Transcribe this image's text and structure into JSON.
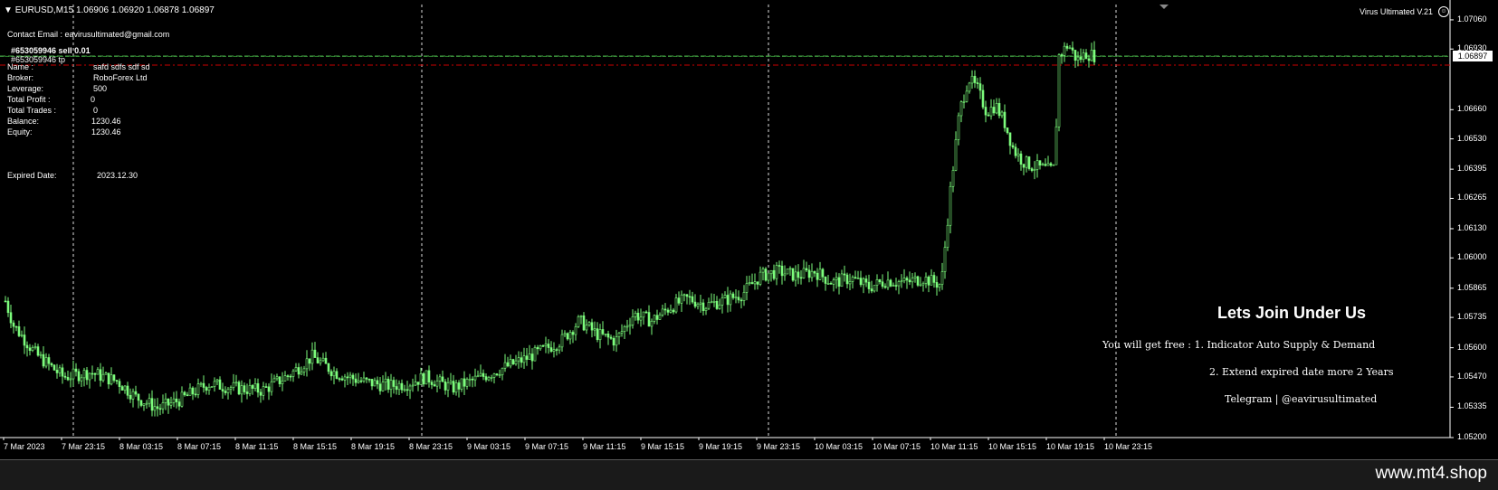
{
  "chart_header": {
    "symbol": "EURUSD,M15",
    "ohlc": "1.06906 1.06920 1.06878 1.06897",
    "indicator_name": "Virus Ultimated V.21"
  },
  "info_panel": {
    "contact": "Contact Email : eavirusultimated@gmail.com",
    "order_sell": "#653059946 sell 0.01",
    "order_tp": "#653059946 tp",
    "rows": [
      {
        "label": "Name :",
        "value": "safd   sdfs sdf  sd"
      },
      {
        "label": "Broker:",
        "value": "RoboForex Ltd"
      },
      {
        "label": "Leverage:",
        "value": "500"
      },
      {
        "label": "Total Profit :",
        "value": "0"
      },
      {
        "label": "Total Trades :",
        "value": "0"
      },
      {
        "label": "Balance:",
        "value": "1230.46"
      },
      {
        "label": "Equity:",
        "value": "1230.46"
      }
    ],
    "expired_label": "Expired Date:",
    "expired_value": "2023.12.30"
  },
  "promo": {
    "title": "Lets Join Under Us",
    "line1": "You will get free : 1. Indicator Auto Supply & Demand",
    "line2": "2. Extend expired date more 2 Years",
    "line3": "Telegram | @eavirusultimated"
  },
  "footer": {
    "brand": "www.mt4.shop"
  },
  "colors": {
    "candle": "#7CFC7C",
    "bid_line": "#2e8b2e",
    "sell_line": "#cc0000",
    "background": "#000000",
    "grid": "#ffffff"
  },
  "chart_data": {
    "type": "candlestick",
    "current_price": "1.06897",
    "ylim": [
      1.052,
      1.071
    ],
    "y_ticks": [
      "1.07060",
      "1.06930",
      "1.06897",
      "1.06660",
      "1.06530",
      "1.06395",
      "1.06265",
      "1.06130",
      "1.06000",
      "1.05865",
      "1.05735",
      "1.05600",
      "1.05470",
      "1.05335",
      "1.05200"
    ],
    "x_ticks": [
      "7 Mar 2023",
      "7 Mar 23:15",
      "8 Mar 03:15",
      "8 Mar 07:15",
      "8 Mar 11:15",
      "8 Mar 15:15",
      "8 Mar 19:15",
      "8 Mar 23:15",
      "9 Mar 03:15",
      "9 Mar 07:15",
      "9 Mar 11:15",
      "9 Mar 15:15",
      "9 Mar 19:15",
      "9 Mar 23:15",
      "10 Mar 03:15",
      "10 Mar 07:15",
      "10 Mar 11:15",
      "10 Mar 15:15",
      "10 Mar 19:15",
      "10 Mar 23:15"
    ],
    "close_path": [
      [
        0,
        1.0588
      ],
      [
        15,
        1.057
      ],
      [
        40,
        1.0557
      ],
      [
        70,
        1.0547
      ],
      [
        100,
        1.0549
      ],
      [
        130,
        1.0545
      ],
      [
        150,
        1.0538
      ],
      [
        175,
        1.0533
      ],
      [
        200,
        1.0537
      ],
      [
        230,
        1.0544
      ],
      [
        260,
        1.0542
      ],
      [
        290,
        1.0541
      ],
      [
        320,
        1.0548
      ],
      [
        345,
        1.0556
      ],
      [
        370,
        1.0549
      ],
      [
        400,
        1.0545
      ],
      [
        430,
        1.0543
      ],
      [
        450,
        1.0544
      ],
      [
        470,
        1.0547
      ],
      [
        500,
        1.0542
      ],
      [
        520,
        1.0545
      ],
      [
        550,
        1.055
      ],
      [
        580,
        1.0555
      ],
      [
        600,
        1.0559
      ],
      [
        620,
        1.0563
      ],
      [
        640,
        1.0572
      ],
      [
        660,
        1.0566
      ],
      [
        680,
        1.0563
      ],
      [
        700,
        1.0575
      ],
      [
        720,
        1.0572
      ],
      [
        740,
        1.0578
      ],
      [
        760,
        1.0582
      ],
      [
        780,
        1.0579
      ],
      [
        800,
        1.0581
      ],
      [
        820,
        1.0584
      ],
      [
        840,
        1.0592
      ],
      [
        860,
        1.0594
      ],
      [
        880,
        1.0592
      ],
      [
        900,
        1.0594
      ],
      [
        920,
        1.0589
      ],
      [
        940,
        1.0591
      ],
      [
        960,
        1.0587
      ],
      [
        980,
        1.059
      ],
      [
        1000,
        1.0589
      ],
      [
        1020,
        1.0591
      ],
      [
        1040,
        1.0588
      ],
      [
        1050,
        1.063
      ],
      [
        1060,
        1.0665
      ],
      [
        1070,
        1.068
      ],
      [
        1080,
        1.0675
      ],
      [
        1090,
        1.0665
      ],
      [
        1100,
        1.0668
      ],
      [
        1110,
        1.066
      ],
      [
        1120,
        1.0648
      ],
      [
        1130,
        1.0643
      ],
      [
        1140,
        1.0641
      ],
      [
        1150,
        1.064
      ],
      [
        1160,
        1.0639
      ],
      [
        1165,
        1.064
      ],
      [
        1170,
        1.069
      ],
      [
        1180,
        1.0695
      ],
      [
        1190,
        1.0688
      ],
      [
        1200,
        1.0691
      ],
      [
        1210,
        1.069
      ]
    ]
  }
}
